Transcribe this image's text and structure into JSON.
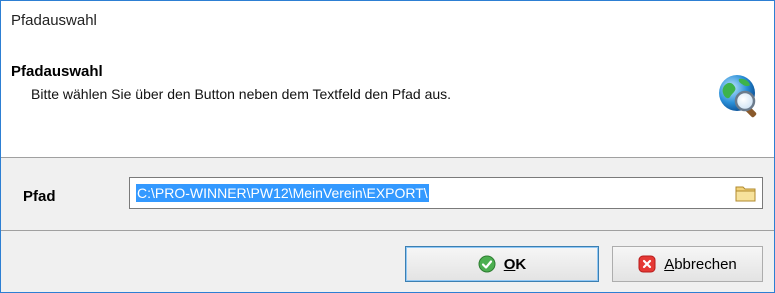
{
  "window": {
    "title": "Pfadauswahl"
  },
  "header": {
    "title": "Pfadauswahl",
    "subtitle": "Bitte wählen Sie über den Button neben dem Textfeld den Pfad aus.",
    "icon": "globe-search-icon"
  },
  "path": {
    "label": "Pfad",
    "value": "C:\\PRO-WINNER\\PW12\\MeinVerein\\EXPORT\\",
    "browse_icon": "folder-icon"
  },
  "buttons": {
    "ok": {
      "mnemonic": "O",
      "rest": "K",
      "icon": "checkmark-icon"
    },
    "cancel": {
      "mnemonic": "A",
      "rest": "bbrechen",
      "icon": "cancel-x-icon"
    }
  },
  "colors": {
    "selection": "#3399ff",
    "accent_border": "#2d7fd3",
    "ok_icon": "#4caf50",
    "cancel_icon": "#e53935"
  }
}
